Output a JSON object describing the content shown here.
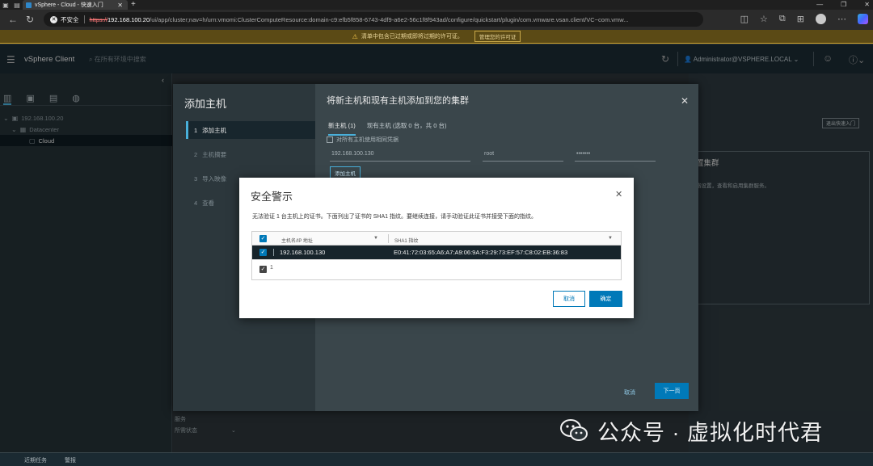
{
  "browser": {
    "tab_title": "vSphere - Cloud - 快速入门",
    "insecure_label": "不安全",
    "url_scheme": "https://",
    "url_host": "192.168.100.20",
    "url_path": "/ui/app/cluster;nav=h/urn:vmomi:ClusterComputeResource:domain-c9:efb5f858-6743-4df9-a6e2-56c1f8f943ad/configure/quickstart/plugin/com.vmware.vsan.client/VC~com.vmw..."
  },
  "banner": {
    "text": "清单中包含已过期或即将过期的许可证。",
    "button": "管理您的许可证"
  },
  "header": {
    "brand": "vSphere Client",
    "search_placeholder": "在所有环境中搜索",
    "user": "Administrator@VSPHERE.LOCAL"
  },
  "tree": {
    "vcenter": "192.168.100.20",
    "datacenter": "Datacenter",
    "cluster": "Cloud"
  },
  "left_bottom": {
    "item1": "服务",
    "item2": "所需状态"
  },
  "background": {
    "exit_button": "退出快速入门",
    "card_title": "置集群",
    "card_desc": "络设置，查看和启用集群服务。"
  },
  "statusbar": {
    "recent_tasks": "近期任务",
    "alarms": "警报"
  },
  "wizard": {
    "title": "添加主机",
    "steps": [
      {
        "num": "1",
        "label": "添加主机"
      },
      {
        "num": "2",
        "label": "主机摘要"
      },
      {
        "num": "3",
        "label": "导入映像"
      },
      {
        "num": "4",
        "label": "查看"
      }
    ],
    "right_title": "将新主机和现有主机添加到您的集群",
    "tabs": [
      "新主机 (1)",
      "现有主机 (选取 0 台，共 0 台)"
    ],
    "same_credentials": "对所有主机使用相同凭据",
    "host_ip": "192.168.100.130",
    "username": "root",
    "password_mask": "•••••••",
    "add_host_button": "添加主机",
    "cancel": "取消",
    "next": "下一页"
  },
  "alert": {
    "title": "安全警示",
    "message": "无法验证 1 台主机上的证书。下面列出了证书的 SHA1 指纹。要继续连接，请手动验证此证书并接受下面的指纹。",
    "col_host": "主机名/IP 地址",
    "col_sha1": "SHA1 指纹",
    "row": {
      "host": "192.168.100.130",
      "sha1": "E0:41:72:03:65:A6:A7:A9:06:9A:F3:29:73:EF:57:C8:02:EB:36:83"
    },
    "count": "1",
    "cancel": "取消",
    "ok": "确定"
  },
  "watermark": {
    "text": "公众号 · 虚拟化时代君"
  },
  "colors": {
    "accent": "#0079b8",
    "nav_accent": "#49afd9",
    "banner_bg": "#5b4a15"
  }
}
